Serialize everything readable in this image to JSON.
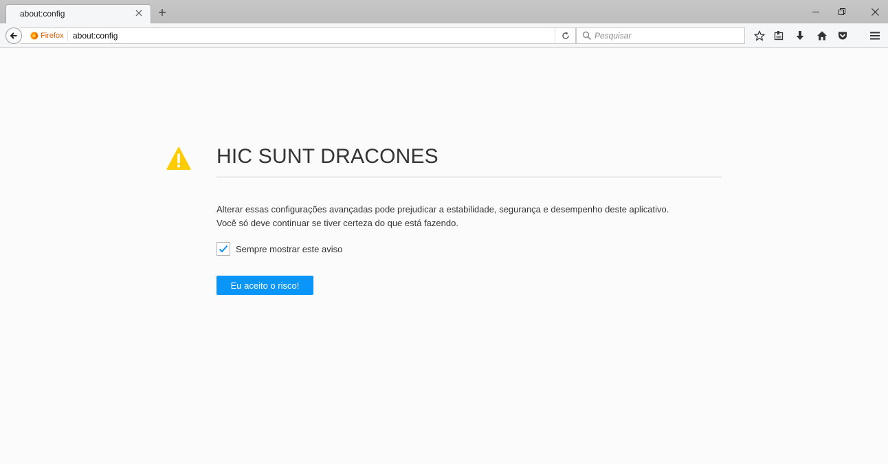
{
  "window": {
    "tab_title": "about:config",
    "controls": {
      "minimize": "minimize-icon",
      "maximize": "restore-icon",
      "close": "close-icon"
    }
  },
  "navbar": {
    "identity_label": "Firefox",
    "url": "about:config",
    "search_placeholder": "Pesquisar",
    "toolbar_icons": [
      "star-icon",
      "reading-list-icon",
      "download-icon",
      "home-icon",
      "pocket-icon",
      "menu-icon"
    ]
  },
  "page": {
    "title": "HIC SUNT DRACONES",
    "description_line1": "Alterar essas configurações avançadas pode prejudicar a estabilidade, segurança e desempenho deste aplicativo.",
    "description_line2": "Você só deve continuar se tiver certeza do que está fazendo.",
    "checkbox_label": "Sempre mostrar este aviso",
    "checkbox_checked": true,
    "accept_button": "Eu aceito o risco!"
  },
  "colors": {
    "accent": "#0996f8",
    "warning": "#ffcc00",
    "firefox_orange": "#e66000"
  }
}
